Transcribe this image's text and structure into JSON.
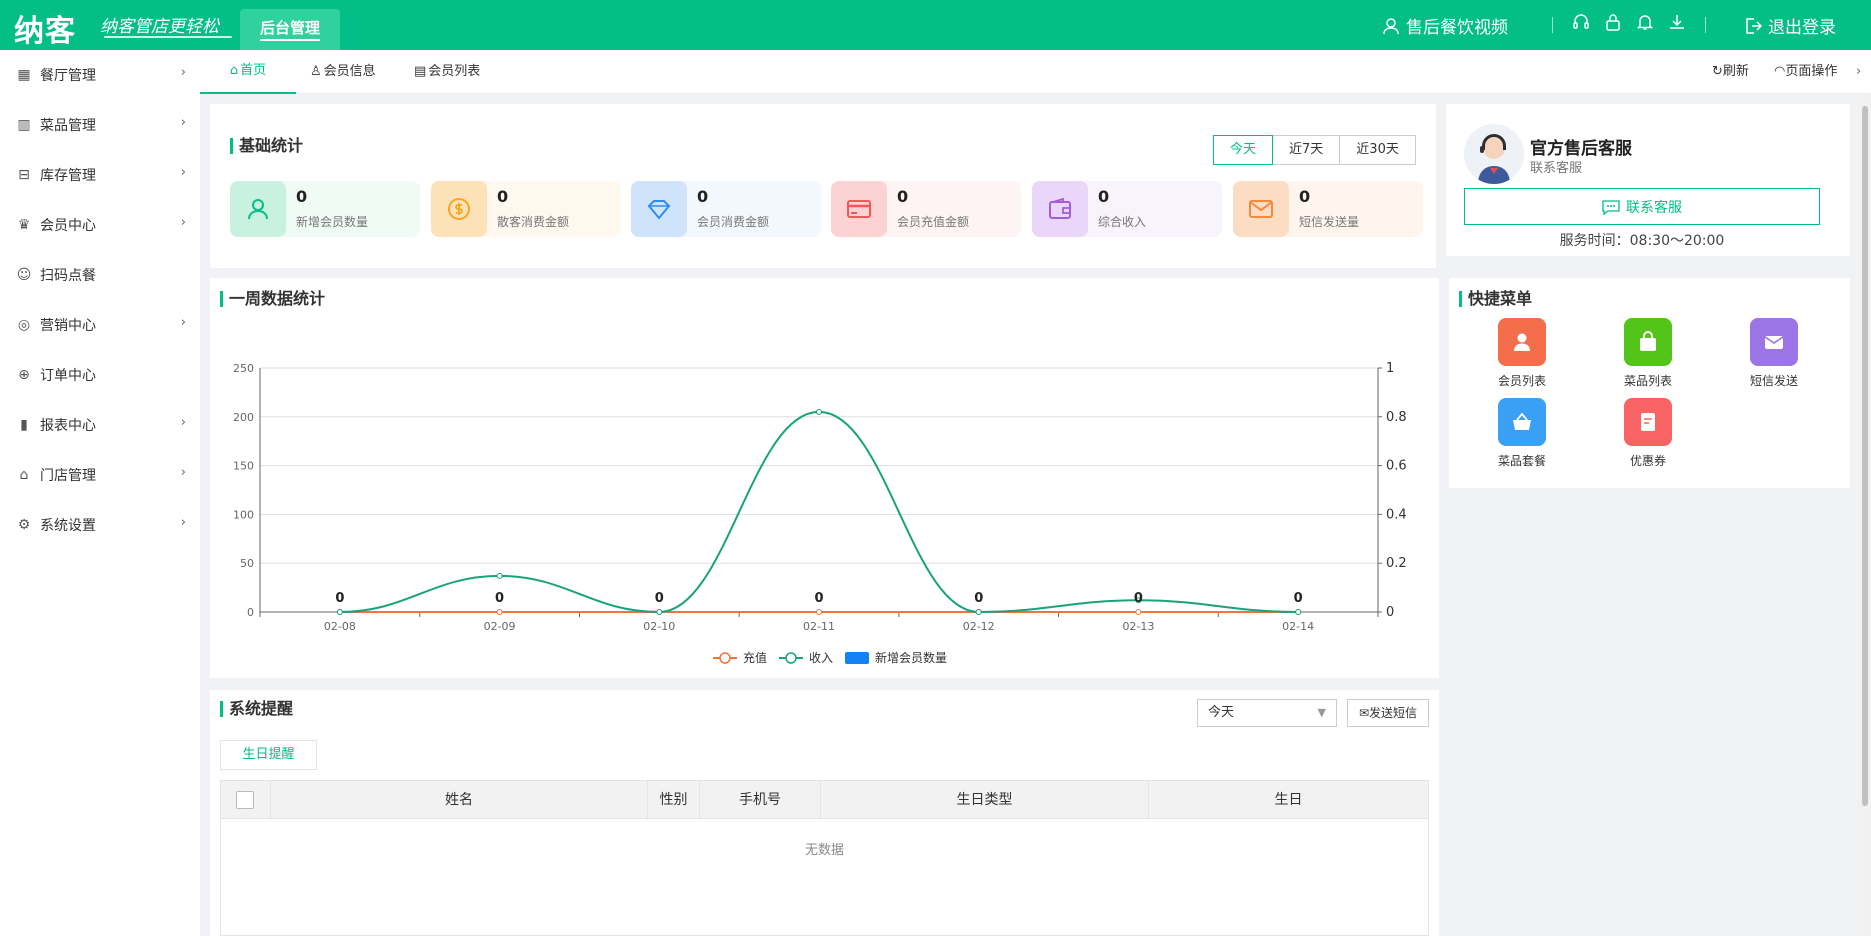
{
  "topbar": {
    "logo": "纳客",
    "slogan": "纳客管店更轻松",
    "admin_tab": "后台管理",
    "user_name": "售后餐饮视频",
    "logout": "退出登录",
    "bg_color": "#03be86"
  },
  "sidebar": {
    "items": [
      {
        "label": "餐厅管理",
        "icon": "restaurant-icon",
        "chevron": true
      },
      {
        "label": "菜品管理",
        "icon": "dish-icon",
        "chevron": true
      },
      {
        "label": "库存管理",
        "icon": "inventory-icon",
        "chevron": true
      },
      {
        "label": "会员中心",
        "icon": "crown-icon",
        "chevron": true
      },
      {
        "label": "扫码点餐",
        "icon": "user-icon",
        "chevron": false
      },
      {
        "label": "营销中心",
        "icon": "target-icon",
        "chevron": true
      },
      {
        "label": "订单中心",
        "icon": "globe-icon",
        "chevron": false
      },
      {
        "label": "报表中心",
        "icon": "bar-chart-icon",
        "chevron": true
      },
      {
        "label": "门店管理",
        "icon": "store-icon",
        "chevron": true
      },
      {
        "label": "系统设置",
        "icon": "gear-icon",
        "chevron": true
      }
    ]
  },
  "tabs": {
    "items": [
      {
        "label": "首页",
        "active": true
      },
      {
        "label": "会员信息",
        "active": false
      },
      {
        "label": "会员列表",
        "active": false
      }
    ],
    "refresh": "刷新",
    "page_ops": "页面操作"
  },
  "basic_stats": {
    "title": "基础统计",
    "ranges": [
      "今天",
      "近7天",
      "近30天"
    ],
    "active_range": "今天",
    "cards": [
      {
        "value": "0",
        "label": "新增会员数量",
        "icon": "user-icon",
        "color": "#03be86",
        "bg": "#f0fbf5",
        "icbg": "#c9f1df"
      },
      {
        "value": "0",
        "label": "散客消费金额",
        "icon": "coin-icon",
        "color": "#f5a623",
        "bg": "#fff8ef",
        "icbg": "#fde2b8"
      },
      {
        "value": "0",
        "label": "会员消费金额",
        "icon": "diamond-icon",
        "color": "#2e8cf0",
        "bg": "#f3f8fe",
        "icbg": "#cfe4fb"
      },
      {
        "value": "0",
        "label": "会员充值金额",
        "icon": "card-icon",
        "color": "#f25858",
        "bg": "#fff4f4",
        "icbg": "#fcd3d3"
      },
      {
        "value": "0",
        "label": "综合收入",
        "icon": "wallet-icon",
        "color": "#a25ddc",
        "bg": "#f9f3fe",
        "icbg": "#ead6f9"
      },
      {
        "value": "0",
        "label": "短信发送量",
        "icon": "mail-icon",
        "color": "#f38b3c",
        "bg": "#fff5ee",
        "icbg": "#fddcc4"
      }
    ]
  },
  "service": {
    "name": "官方售后客服",
    "subtitle": "联系客服",
    "button": "联系客服",
    "hours": "服务时间：08:30～20:00"
  },
  "weekly": {
    "title": "一周数据统计"
  },
  "chart_data": {
    "type": "line",
    "title": "",
    "x": [
      "02-08",
      "02-09",
      "02-10",
      "02-11",
      "02-12",
      "02-13",
      "02-14"
    ],
    "ylim": [
      0,
      250
    ],
    "y_ticks": [
      0,
      50,
      100,
      150,
      200,
      250
    ],
    "y2lim": [
      0,
      1
    ],
    "y2_ticks": [
      "0",
      "0.2",
      "0.4",
      "0.6",
      "0.8",
      "1"
    ],
    "grid": true,
    "legend": "bottom-center",
    "series": [
      {
        "name": "充值",
        "type": "line",
        "axis": "left",
        "color": "#f0743c",
        "values": [
          0,
          0,
          0,
          0,
          0,
          0,
          0
        ]
      },
      {
        "name": "收入",
        "type": "line",
        "smooth": true,
        "axis": "left",
        "color": "#1aa37a",
        "values": [
          0,
          37,
          0,
          205,
          0,
          12,
          0
        ]
      },
      {
        "name": "新增会员数量",
        "type": "bar",
        "axis": "right",
        "color": "#1282f4",
        "values": [
          0,
          0,
          0,
          0,
          0,
          0,
          0
        ]
      }
    ],
    "data_labels": [
      "0",
      "0",
      "0",
      "0",
      "0",
      "0",
      "0"
    ]
  },
  "quick_menu": {
    "title": "快捷菜单",
    "items": [
      {
        "label": "会员列表",
        "icon": "user-icon",
        "color": "#f46e4c"
      },
      {
        "label": "菜品列表",
        "icon": "bag-icon",
        "color": "#52c41a"
      },
      {
        "label": "短信发送",
        "icon": "mail-icon",
        "color": "#9b74e5"
      },
      {
        "label": "菜品套餐",
        "icon": "basket-icon",
        "color": "#3aa0f5"
      },
      {
        "label": "优惠券",
        "icon": "coupon-icon",
        "color": "#f86464"
      }
    ]
  },
  "reminders": {
    "title": "系统提醒",
    "select_value": "今天",
    "sms_button": "发送短信",
    "tab": "生日提醒",
    "columns": [
      "姓名",
      "性别",
      "手机号",
      "生日类型",
      "生日"
    ],
    "empty": "无数据"
  }
}
